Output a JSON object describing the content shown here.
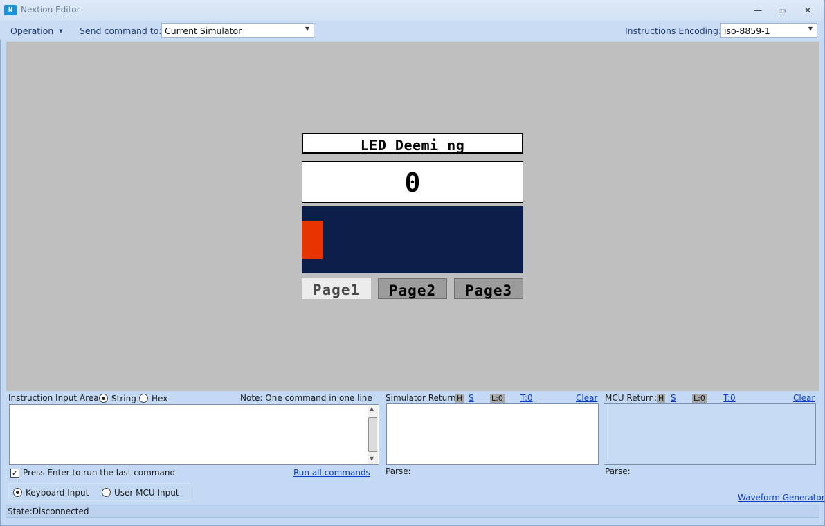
{
  "window": {
    "title": "Nextion Editor",
    "minimize_glyph": "—",
    "maximize_glyph": "▭",
    "close_glyph": "✕"
  },
  "toolbar": {
    "operation_label": "Operation",
    "send_label": "Send command to:",
    "send_value": "Current Simulator",
    "encoding_label": "Instructions Encoding:",
    "encoding_value": "iso-8859-1",
    "dropdown_glyph": "▼"
  },
  "device": {
    "title": "LED Deemi ng",
    "value": "0",
    "slider_level": 0.0,
    "pages": [
      "Page1",
      "Page2",
      "Page3"
    ],
    "colors": {
      "slider_bg": "#0c1f4a",
      "slider_cursor": "#e83400"
    }
  },
  "instruction": {
    "area_label": "Instruction Input Area:",
    "mode_string": "String",
    "mode_hex": "Hex",
    "selected_mode": "String",
    "note": "Note: One command in one line",
    "enter_check_label": "Press Enter to run the last command",
    "enter_checked": true,
    "run_all_label": "Run all commands",
    "keyboard_input": "Keyboard Input",
    "mcu_input": "User MCU Input"
  },
  "simulator_return": {
    "label": "Simulator Return:",
    "h": "H",
    "s": "S",
    "l": "L:0",
    "t": "T:0",
    "clear": "Clear",
    "parse": "Parse:"
  },
  "mcu_return": {
    "label": "MCU Return:",
    "h": "H",
    "s": "S",
    "l": "L:0",
    "t": "T:0",
    "clear": "Clear",
    "parse": "Parse:"
  },
  "footer": {
    "waveform_link": "Waveform Generator",
    "state": "State:Disconnected"
  }
}
